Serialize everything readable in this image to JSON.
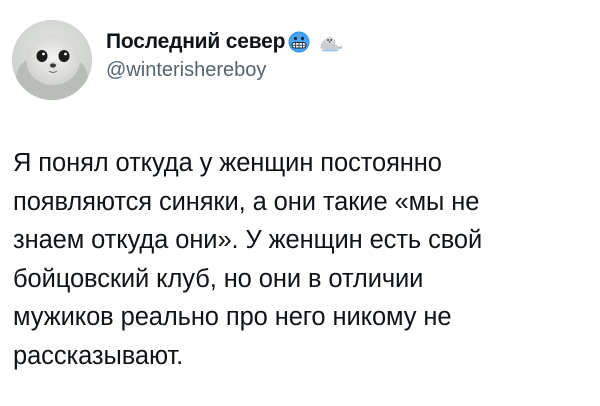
{
  "author": {
    "display_name": "Последний север",
    "handle": "@winterishereboy",
    "avatar_icon": "seal-pup-avatar",
    "name_emojis": [
      "grimacing-face-emoji",
      "seal-emoji"
    ]
  },
  "tweet": {
    "lines": [
      "Я понял откуда у женщин постоянно",
      "появляются синяки, а они такие «мы не",
      "знаем откуда они». У женщин есть свой",
      "бойцовский клуб, но они в отличии",
      "мужиков реально про него никому не",
      "рассказывают."
    ]
  },
  "colors": {
    "text_primary": "#0f1419",
    "text_secondary": "#536471",
    "background": "#ffffff"
  }
}
